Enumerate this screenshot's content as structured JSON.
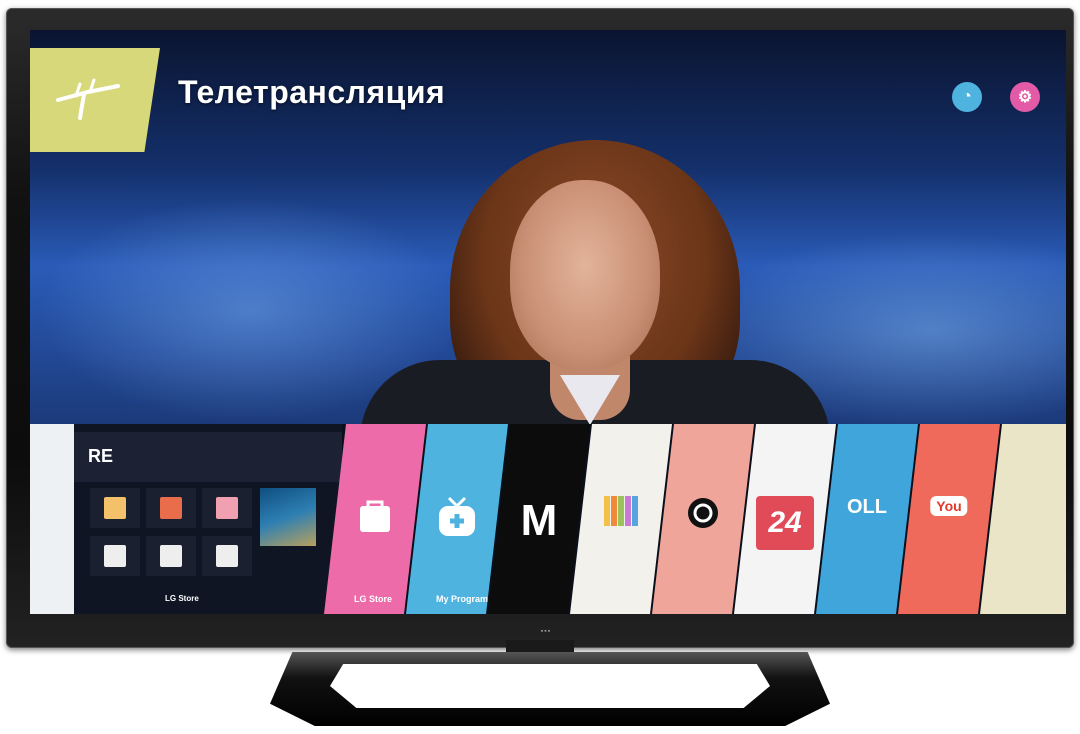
{
  "header": {
    "title": "Телетрансляция",
    "tile_color": "#d7d87a",
    "icons": [
      "antenna-icon",
      "circle-a-icon",
      "gear-icon"
    ]
  },
  "more_panel": {
    "title": "RE",
    "store_label": "LG Store"
  },
  "apps": [
    {
      "label": "LG Store",
      "color": "#ec6ba8",
      "icon": "shopping-bag-icon"
    },
    {
      "label": "My Program",
      "color": "#4fb3e0",
      "icon": "tv-plus-icon"
    },
    {
      "label": "",
      "color": "#0c0c0c",
      "icon": "m-logo-icon"
    },
    {
      "label": "",
      "color": "#f3f1ec",
      "icon": "colorbars-icon"
    },
    {
      "label": "",
      "color": "#f0a59a",
      "icon": "globe-icon"
    },
    {
      "label": "24",
      "color": "#f4f4f4",
      "icon": "channel-24-icon"
    },
    {
      "label": "OLL",
      "color": "#3fa5da",
      "icon": "oll-icon"
    },
    {
      "label": "You",
      "color": "#ef6a5b",
      "icon": "youtube-icon"
    },
    {
      "label": "",
      "color": "#e9e5c6",
      "icon": "app-icon"
    }
  ]
}
